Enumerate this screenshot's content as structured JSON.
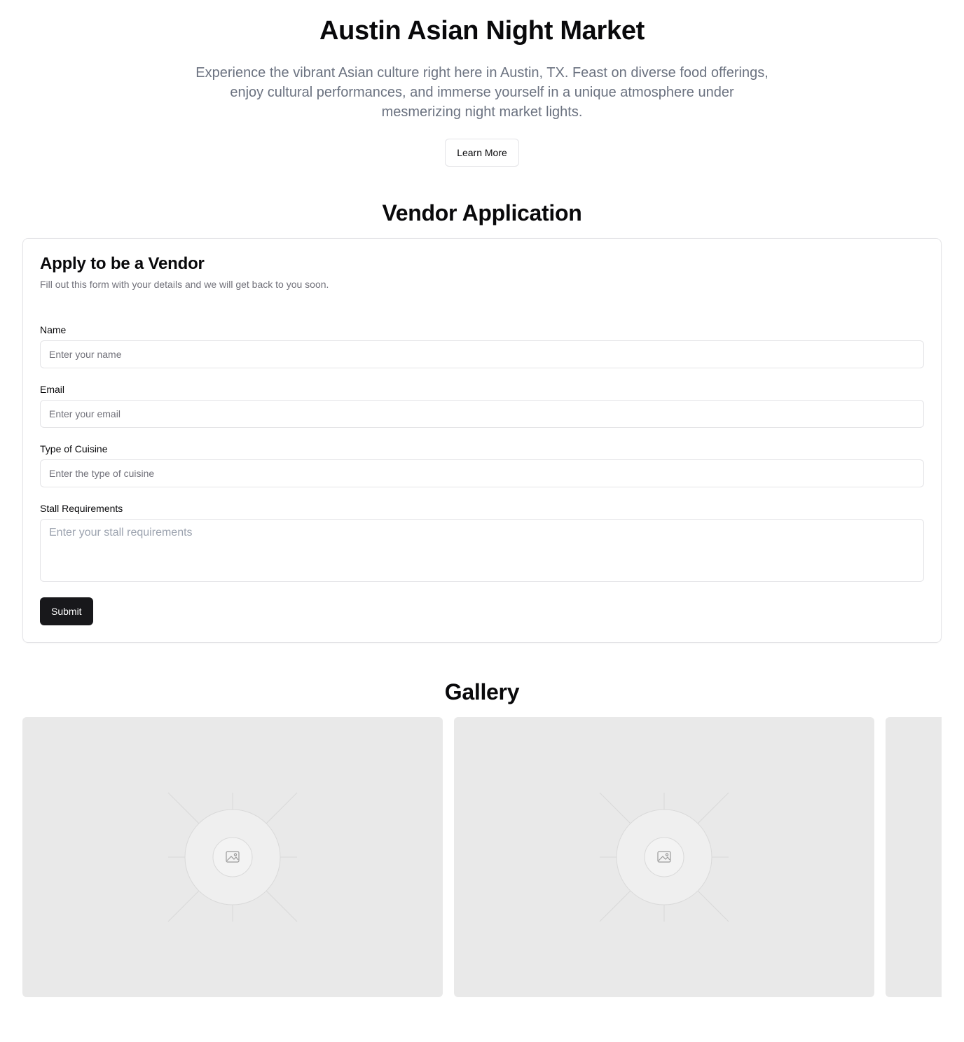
{
  "hero": {
    "title": "Austin Asian Night Market",
    "description": "Experience the vibrant Asian culture right here in Austin, TX. Feast on diverse food offerings, enjoy cultural performances, and immerse yourself in a unique atmosphere under mesmerizing night market lights.",
    "learn_more_label": "Learn More"
  },
  "vendor": {
    "section_title": "Vendor Application",
    "card_title": "Apply to be a Vendor",
    "card_description": "Fill out this form with your details and we will get back to you soon.",
    "fields": {
      "name": {
        "label": "Name",
        "placeholder": "Enter your name",
        "value": ""
      },
      "email": {
        "label": "Email",
        "placeholder": "Enter your email",
        "value": ""
      },
      "cuisine": {
        "label": "Type of Cuisine",
        "placeholder": "Enter the type of cuisine",
        "value": ""
      },
      "stall": {
        "label": "Stall Requirements",
        "placeholder": "Enter your stall requirements",
        "value": ""
      }
    },
    "submit_label": "Submit"
  },
  "gallery": {
    "section_title": "Gallery",
    "items": [
      {
        "icon": "image-placeholder-icon"
      },
      {
        "icon": "image-placeholder-icon"
      },
      {
        "icon": "image-placeholder-icon"
      }
    ]
  },
  "colors": {
    "primary_button": "#18181b",
    "muted_text": "#6b7280",
    "border": "#e4e4e7",
    "placeholder_bg": "#e9e9e9"
  }
}
